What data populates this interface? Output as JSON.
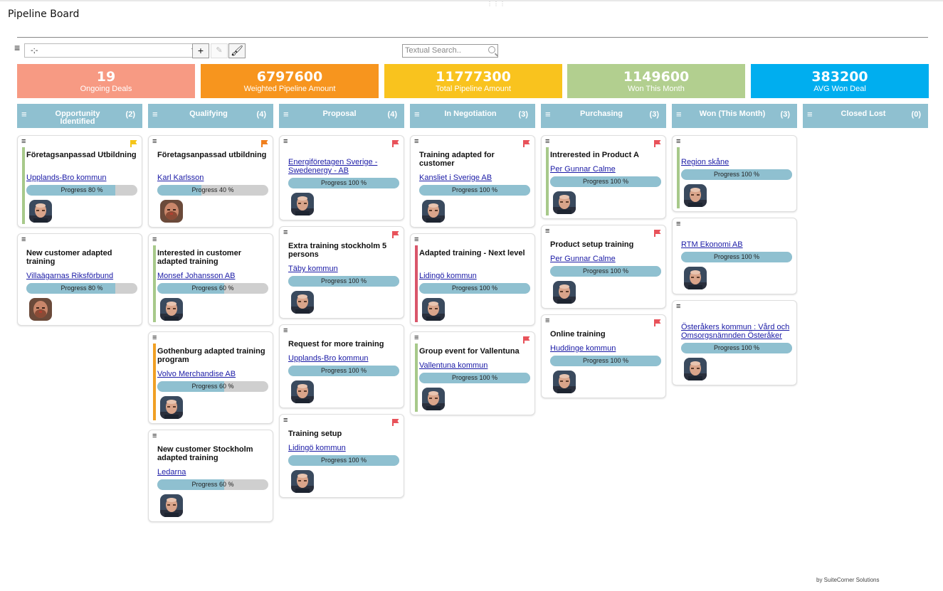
{
  "page": {
    "title": "Pipeline Board",
    "credit": "by SuiteCorner Solutions"
  },
  "toolbar": {
    "selected_view": "-;-",
    "search_placeholder": "Textual Search.."
  },
  "kpis": [
    {
      "value": "19",
      "label": "Ongoing Deals",
      "color": "#f79a83"
    },
    {
      "value": "6797600",
      "label": "Weighted Pipeline Amount",
      "color": "#f7951e"
    },
    {
      "value": "11777300",
      "label": "Total Pipeline Amount",
      "color": "#f9c31e"
    },
    {
      "value": "1149600",
      "label": "Won This Month",
      "color": "#b2cf8f"
    },
    {
      "value": "383200",
      "label": "AVG Won Deal",
      "color": "#00aeef"
    }
  ],
  "columns": [
    {
      "title": "Opportunity Identified",
      "count": "(2)"
    },
    {
      "title": "Qualifying",
      "count": "(4)"
    },
    {
      "title": "Proposal",
      "count": "(4)"
    },
    {
      "title": "In Negotiation",
      "count": "(3)"
    },
    {
      "title": "Purchasing",
      "count": "(3)"
    },
    {
      "title": "Won (This Month)",
      "count": "(3)"
    },
    {
      "title": "Closed Lost",
      "count": "(0)"
    }
  ],
  "cards": [
    [
      {
        "title": "Företagsanpassad Utbildning",
        "link": "Upplands-Bro kommun",
        "progress": 80,
        "progress_text": "Progress 80 %",
        "flag": "#f5c518",
        "bar": "#a7c98a",
        "avatar": "avatar-b"
      },
      {
        "title": "New customer adapted training",
        "link": "Villaägarnas Riksförbund",
        "progress": 80,
        "progress_text": "Progress 80 %",
        "flag": "",
        "bar": "",
        "avatar": "avatar-a"
      }
    ],
    [
      {
        "title": "Företagsanpassad utbildning",
        "link": "Karl Karlsson",
        "progress": 40,
        "progress_text": "Progress 40 %",
        "flag": "#f07f1e",
        "bar": "",
        "avatar": "avatar-a"
      },
      {
        "title": "Interested in customer adapted training",
        "link": "Monsef Johansson AB",
        "progress": 60,
        "progress_text": "Progress 60 %",
        "flag": "",
        "bar": "#a7c98a",
        "avatar": "avatar-b"
      },
      {
        "title": "Gothenburg adapted training program",
        "link": "Volvo Merchandise AB",
        "progress": 60,
        "progress_text": "Progress 60 %",
        "flag": "",
        "bar": "#f0a024",
        "avatar": "avatar-b"
      },
      {
        "title": "New customer Stockholm adapted training",
        "link": "Ledarna",
        "progress": 60,
        "progress_text": "Progress 60 %",
        "flag": "",
        "bar": "",
        "avatar": "avatar-b"
      }
    ],
    [
      {
        "title": "",
        "link": "Energiföretagen Sverige - Swedenergy - AB",
        "progress": 100,
        "progress_text": "Progress 100 %",
        "flag": "#e8525a",
        "bar": "",
        "avatar": "avatar-b"
      },
      {
        "title": "Extra training stockholm 5 persons",
        "link": "Täby kommun",
        "progress": 100,
        "progress_text": "Progress 100 %",
        "flag": "#e8525a",
        "bar": "",
        "avatar": "avatar-b"
      },
      {
        "title": "Request for more training",
        "link": "Upplands-Bro kommun",
        "progress": 100,
        "progress_text": "Progress 100 %",
        "flag": "",
        "bar": "",
        "avatar": "avatar-b"
      },
      {
        "title": "Training setup",
        "link": "Lidingö kommun",
        "progress": 100,
        "progress_text": "Progress 100 %",
        "flag": "#e8525a",
        "bar": "",
        "avatar": "avatar-b"
      }
    ],
    [
      {
        "title": "Training adapted for customer",
        "link": "Kansliet i Sverige AB",
        "progress": 100,
        "progress_text": "Progress 100 %",
        "flag": "#e8525a",
        "bar": "",
        "avatar": "avatar-b"
      },
      {
        "title": "Adapted training - Next level",
        "link": "Lidingö kommun",
        "progress": 100,
        "progress_text": "Progress 100 %",
        "flag": "",
        "bar": "#d9566a",
        "avatar": "avatar-b"
      },
      {
        "title": "Group event for Vallentuna",
        "link": "Vallentuna kommun",
        "progress": 100,
        "progress_text": "Progress 100 %",
        "flag": "#e8525a",
        "bar": "#a7c98a",
        "avatar": "avatar-b"
      }
    ],
    [
      {
        "title": "Intrerested in Product A",
        "link": "Per Gunnar Calme",
        "progress": 100,
        "progress_text": "Progress 100 %",
        "flag": "#e8525a",
        "bar": "#a7c98a",
        "avatar": "avatar-b"
      },
      {
        "title": "Product setup training",
        "link": "Per Gunnar Calme",
        "progress": 100,
        "progress_text": "Progress 100 %",
        "flag": "#e8525a",
        "bar": "",
        "avatar": "avatar-b"
      },
      {
        "title": "Online training",
        "link": "Huddinge kommun",
        "progress": 100,
        "progress_text": "Progress 100 %",
        "flag": "#e8525a",
        "bar": "",
        "avatar": "avatar-b"
      }
    ],
    [
      {
        "title": "",
        "link": "Region skåne",
        "progress": 100,
        "progress_text": "Progress 100 %",
        "flag": "",
        "bar": "#a7c98a",
        "avatar": "avatar-b"
      },
      {
        "title": "",
        "link": "RTM Ekonomi AB",
        "progress": 100,
        "progress_text": "Progress 100 %",
        "flag": "",
        "bar": "",
        "avatar": "avatar-b"
      },
      {
        "title": "",
        "link": "Österåkers kommun : Vård och Omsorgsnämnden Österåker",
        "progress": 100,
        "progress_text": "Progress 100 %",
        "flag": "",
        "bar": "",
        "avatar": "avatar-b"
      }
    ],
    []
  ]
}
